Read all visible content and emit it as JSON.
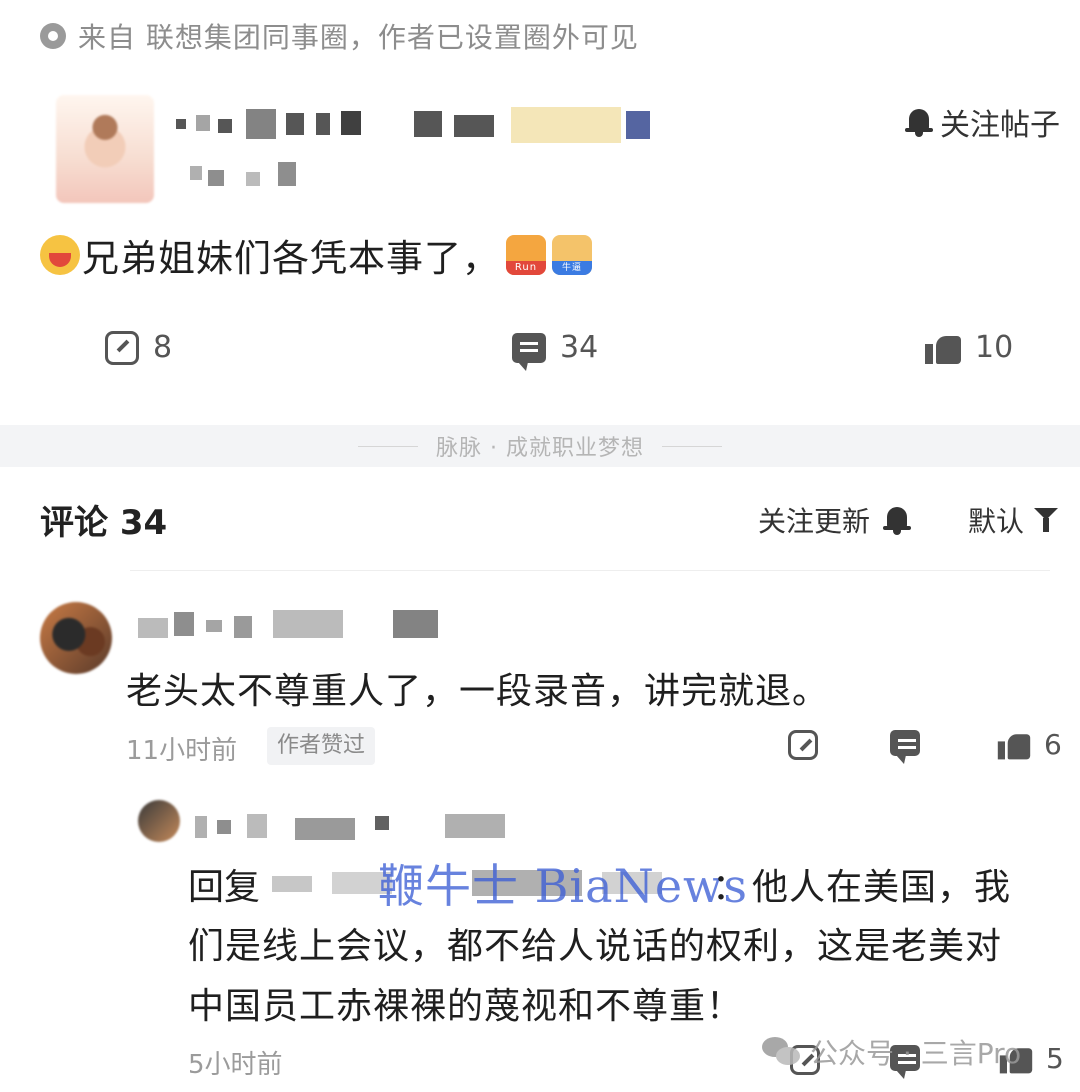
{
  "source": {
    "text": "来自 联想集团同事圈，作者已设置圈外可见"
  },
  "post": {
    "follow_label": "关注帖子",
    "body_text": "兄弟姐妹们各凭本事了，",
    "stats": {
      "shares": "8",
      "comments": "34",
      "likes": "10"
    }
  },
  "divider": {
    "text": "脉脉 · 成就职业梦想"
  },
  "comments_header": {
    "title": "评论 34",
    "follow_updates": "关注更新",
    "sort": "默认"
  },
  "comments": [
    {
      "text": "老头太不尊重人了，一段录音，讲完就退。",
      "time": "11小时前",
      "badge": "作者赞过",
      "likes": "6"
    }
  ],
  "reply": {
    "prefix": "回复",
    "colon": "：",
    "line1": "他人在美国，我",
    "line2": "们是线上会议，都不给人说话的权利，这是老美对",
    "line3": "中国员工赤裸裸的蔑视和不尊重！",
    "time": "5小时前",
    "likes": "5"
  },
  "watermarks": {
    "site": "鞭牛士 BiaNews",
    "account": "公众号 · 三言Pro"
  },
  "colors": {
    "watermark_blue": "#3d5fd6",
    "divider_bg": "#f3f4f6",
    "text_muted": "#8a8a8a"
  },
  "icons": [
    "source-dot-icon",
    "bell-icon",
    "grin-emoji-icon",
    "run-sticker-icon",
    "niu-sticker-icon",
    "share-icon",
    "comment-icon",
    "like-icon",
    "filter-icon",
    "wechat-icon"
  ]
}
